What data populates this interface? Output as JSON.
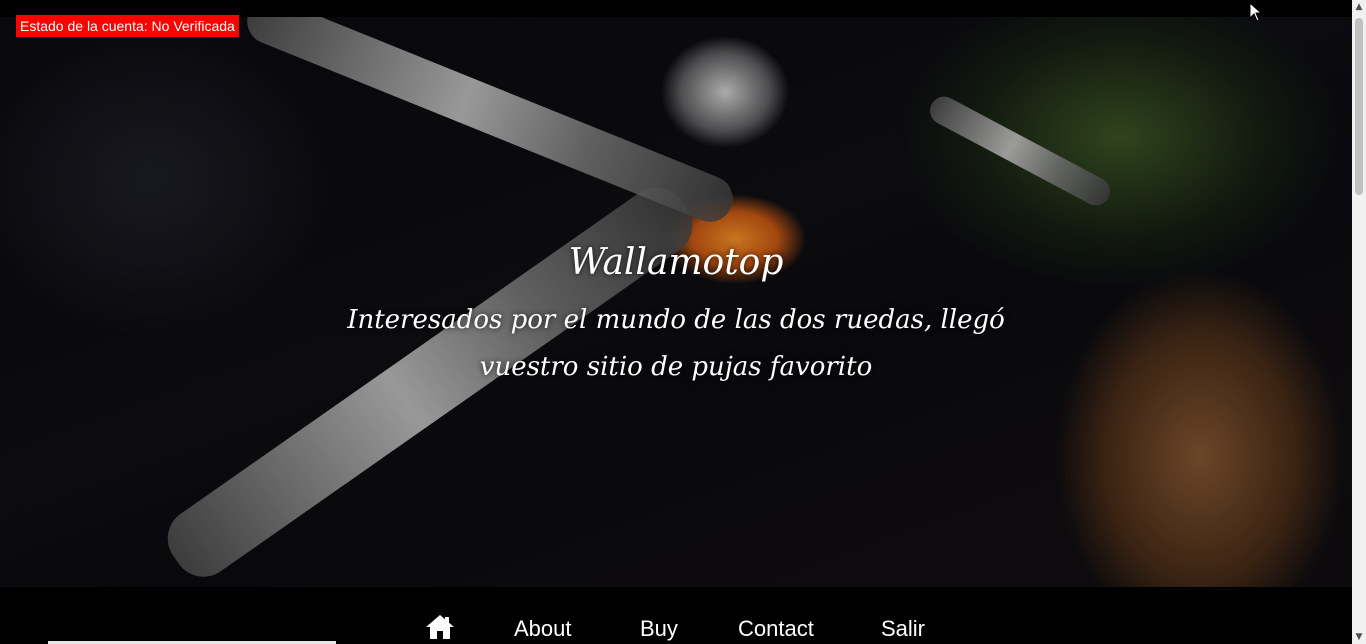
{
  "account_status": {
    "text": "Estado de la cuenta: No Verificada",
    "color": "#ff0000"
  },
  "hero": {
    "title": "Wallamotop",
    "subtitle": "Interesados por el mundo de las dos ruedas, llegó vuestro sitio de pujas favorito"
  },
  "nav": {
    "home_icon": "home-icon",
    "items": [
      {
        "label": "About"
      },
      {
        "label": "Buy"
      },
      {
        "label": "Contact"
      },
      {
        "label": "Salir"
      }
    ]
  },
  "scrollbar": {
    "up_icon": "scroll-up-arrow-icon",
    "down_icon": "scroll-down-arrow-icon"
  }
}
